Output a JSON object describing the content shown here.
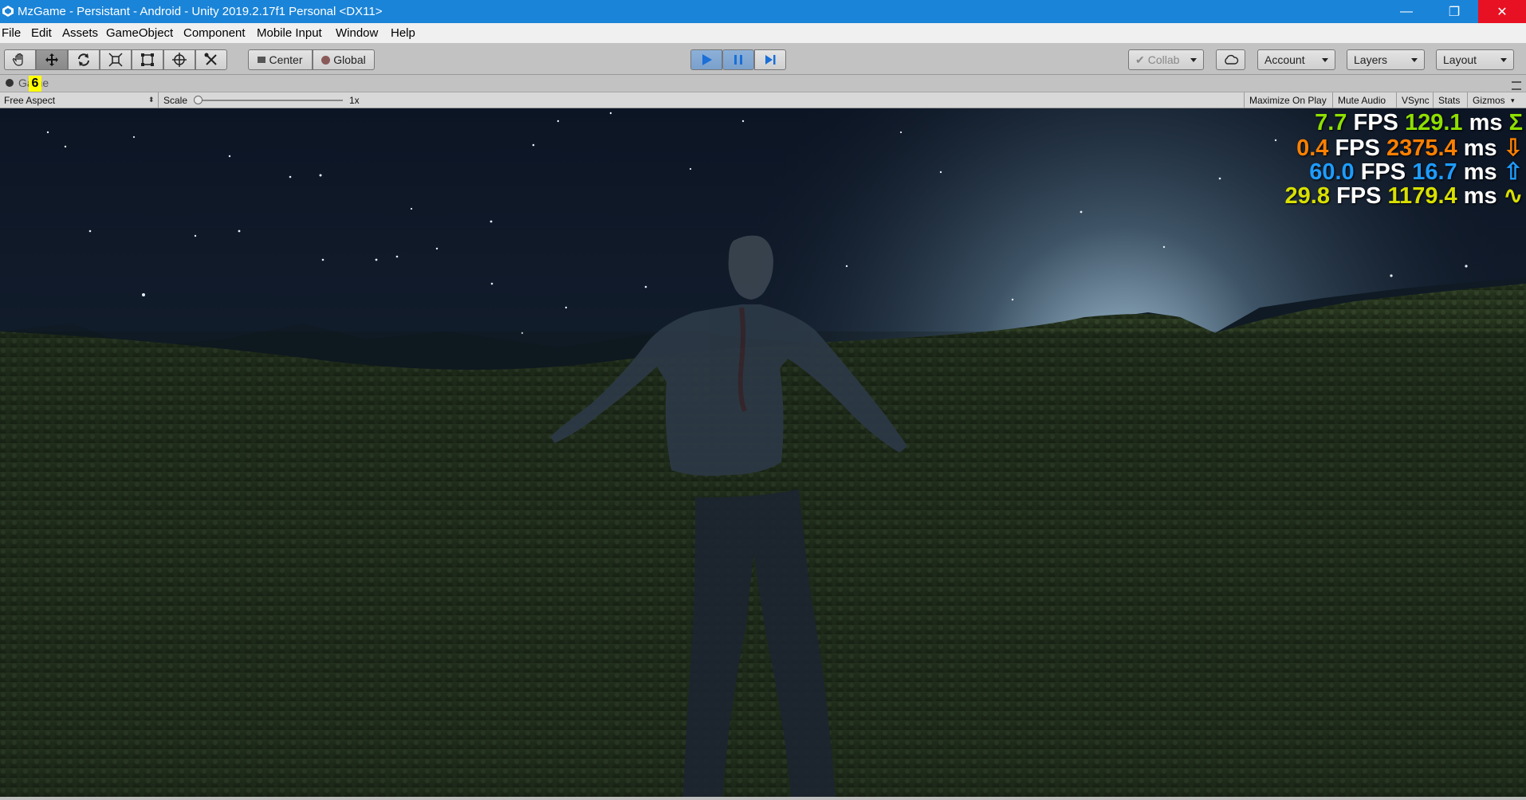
{
  "window": {
    "title": "MzGame - Persistant - Android - Unity 2019.2.17f1 Personal <DX11>",
    "accent_color": "#1a84d8",
    "buttons": {
      "minimize": "—",
      "maximize": "❐",
      "close": "✕"
    }
  },
  "menu": [
    "File",
    "Edit",
    "Assets",
    "GameObject",
    "Component",
    "Mobile Input",
    "Window",
    "Help"
  ],
  "toolbar": {
    "tools": [
      "hand-icon",
      "move-icon",
      "rotate-icon",
      "scale-icon",
      "rect-icon",
      "transform-icon",
      "custom-tool-icon"
    ],
    "active_tool": "move-icon",
    "pivot_label": "Center",
    "space_label": "Global",
    "play_label": "▶",
    "pause_label": "❚❚",
    "step_label": "▶|",
    "collab_label": "Collab",
    "account_label": "Account",
    "layers_label": "Layers",
    "layout_label": "Layout"
  },
  "game_tab": {
    "label": "Game",
    "highlight_badge": "6"
  },
  "game_bar": {
    "aspect": "Free Aspect",
    "scale_label": "Scale",
    "scale_value": "1x",
    "maximize_on_play": "Maximize On Play",
    "mute_audio": "Mute Audio",
    "vsync": "VSync",
    "stats": "Stats",
    "gizmos": "Gizmos"
  },
  "fps_overlay": [
    {
      "fps": "7.7",
      "fps_unit": "FPS",
      "ms": "129.1",
      "ms_unit": "ms",
      "symbol": "Σ",
      "color": "#8fe000"
    },
    {
      "fps": "0.4",
      "fps_unit": "FPS",
      "ms": "2375.4",
      "ms_unit": "ms",
      "symbol": "⇩",
      "color": "#ff8000"
    },
    {
      "fps": "60.0",
      "fps_unit": "FPS",
      "ms": "16.7",
      "ms_unit": "ms",
      "symbol": "⇧",
      "color": "#1e9cff"
    },
    {
      "fps": "29.8",
      "fps_unit": "FPS",
      "ms": "1179.4",
      "ms_unit": "ms",
      "symbol": "∿",
      "color": "#d8e000"
    }
  ]
}
